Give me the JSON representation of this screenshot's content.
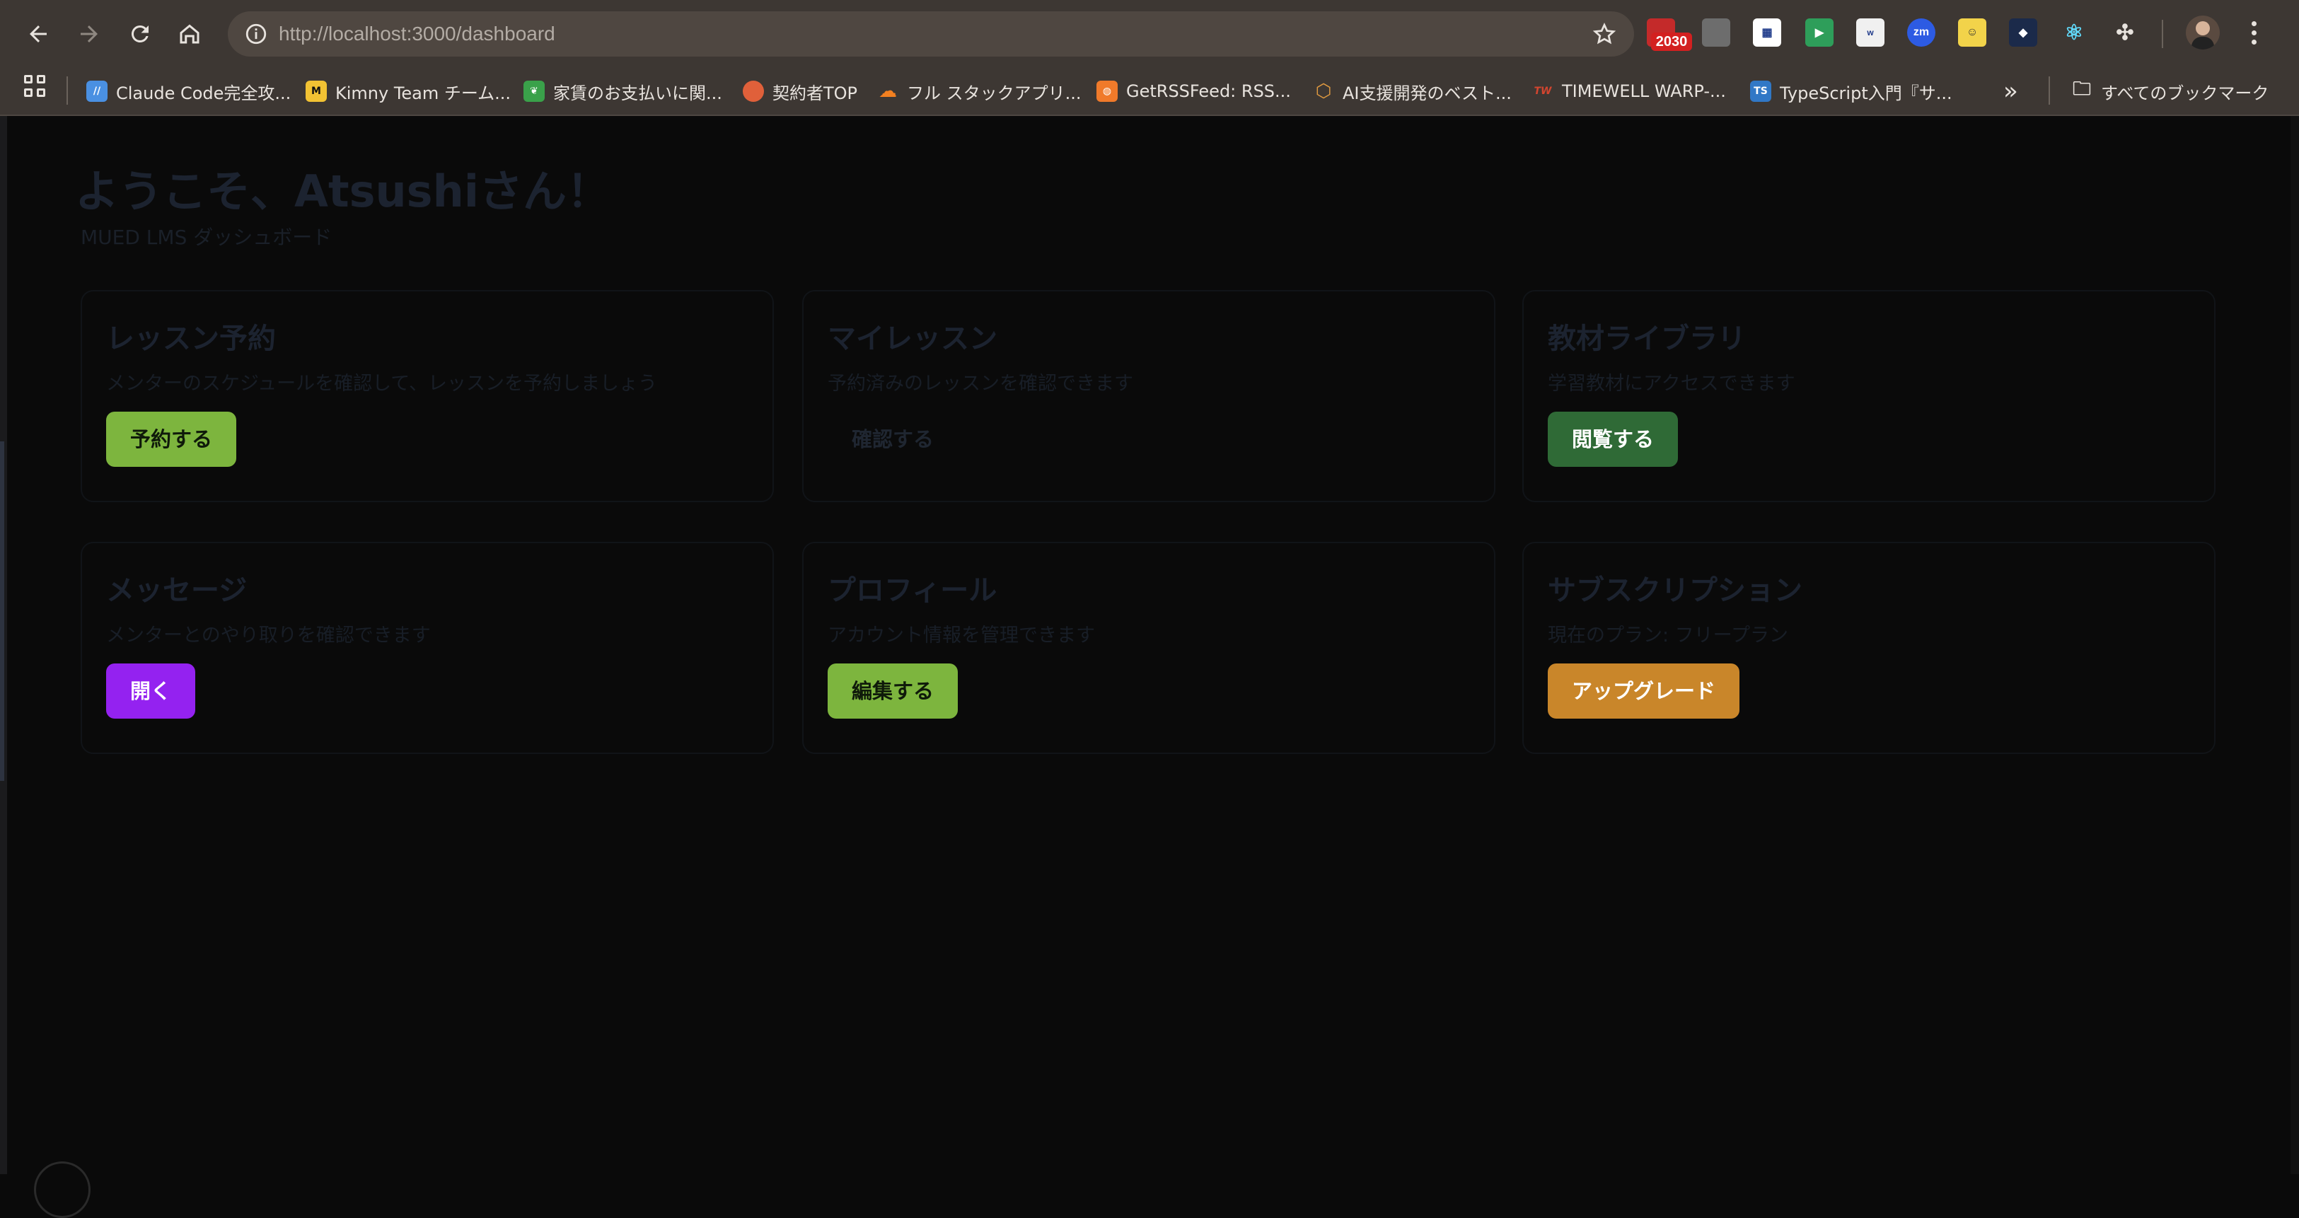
{
  "browser": {
    "url_host": "http://localhost",
    "url_path": ":3000/dashboard",
    "extension_badge": "2030",
    "bookmarks": [
      {
        "label": "Claude Code完全攻...",
        "icon": "claude-code-icon",
        "color": "#4a90e2"
      },
      {
        "label": "Kimny Team チーム...",
        "icon": "miro-icon",
        "color": "#f2c233"
      },
      {
        "label": "家賃のお支払いに関...",
        "icon": "leaf-icon",
        "color": "#3aa14a"
      },
      {
        "label": "契約者TOP",
        "icon": "balloon-icon",
        "color": "#e0603a"
      },
      {
        "label": "フル スタックアプリ...",
        "icon": "cloudflare-icon",
        "color": "#f38020"
      },
      {
        "label": "GetRSSFeed: RSS...",
        "icon": "rss-icon",
        "color": "#f07a2a"
      },
      {
        "label": "AI支援開発のベスト...",
        "icon": "box-icon",
        "color": "#e09a40"
      },
      {
        "label": "TIMEWELL WARP-...",
        "icon": "tw-icon",
        "color": "#d2452f"
      },
      {
        "label": "TypeScript入門『サ...",
        "icon": "typescript-icon",
        "color": "#3178c6"
      }
    ],
    "all_bookmarks_label": "すべてのブックマーク"
  },
  "dashboard": {
    "welcome": "ようこそ、Atsushiさん！",
    "subtitle": "MUED LMS ダッシュボード",
    "cards": [
      {
        "title": "レッスン予約",
        "description": "メンターのスケジュールを確認して、レッスンを予約しましょう",
        "button": "予約する",
        "button_color": "#7db53e"
      },
      {
        "title": "マイレッスン",
        "description": "予約済みのレッスンを確認できます",
        "button": "確認する",
        "button_color": "transparent"
      },
      {
        "title": "教材ライブラリ",
        "description": "学習教材にアクセスできます",
        "button": "閲覧する",
        "button_color": "#2f6a36"
      },
      {
        "title": "メッセージ",
        "description": "メンターとのやり取りを確認できます",
        "button": "開く",
        "button_color": "#9422f0"
      },
      {
        "title": "プロフィール",
        "description": "アカウント情報を管理できます",
        "button": "編集する",
        "button_color": "#7db53e"
      },
      {
        "title": "サブスクリプション",
        "description": "現在のプラン: フリープラン",
        "button": "アップグレード",
        "button_color": "#c9862a"
      }
    ]
  }
}
